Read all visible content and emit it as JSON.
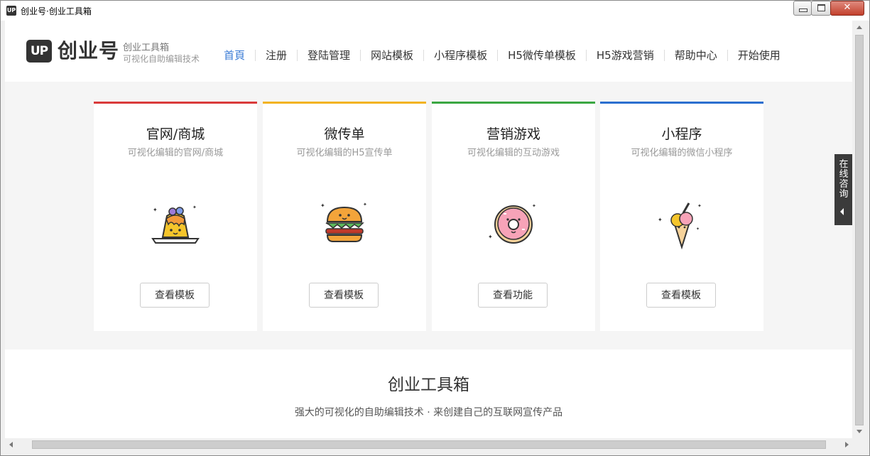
{
  "window": {
    "title": "创业号·创业工具箱",
    "icon": "UP"
  },
  "header": {
    "logo_mark": "UP",
    "logo_text": "创业号",
    "logo_sub1": "创业工具箱",
    "logo_sub2": "可视化自助编辑技术"
  },
  "nav": {
    "items": [
      {
        "label": "首頁"
      },
      {
        "label": "注册"
      },
      {
        "label": "登陆管理"
      },
      {
        "label": "网站模板"
      },
      {
        "label": "小程序模板"
      },
      {
        "label": "H5微传单模板"
      },
      {
        "label": "H5游戏营销"
      },
      {
        "label": "帮助中心"
      },
      {
        "label": "开始使用"
      }
    ],
    "active_color": "#3a7bd5"
  },
  "cards": [
    {
      "title": "官网/商城",
      "subtitle": "可视化编辑的官网/商城",
      "button": "查看模板",
      "accent": "#d93a3a",
      "icon": "pudding-icon"
    },
    {
      "title": "微传单",
      "subtitle": "可视化编辑的H5宣传单",
      "button": "查看模板",
      "accent": "#f2b322",
      "icon": "burger-icon"
    },
    {
      "title": "营销游戏",
      "subtitle": "可视化编辑的互动游戏",
      "button": "查看功能",
      "accent": "#3aa742",
      "icon": "donut-icon"
    },
    {
      "title": "小程序",
      "subtitle": "可视化编辑的微信小程序",
      "button": "查看模板",
      "accent": "#2b6fcf",
      "icon": "ice-cream-icon"
    }
  ],
  "section": {
    "title": "创业工具箱",
    "subtitle": "强大的可视化的自助编辑技术 · 来创建自己的互联网宣传产品"
  },
  "consult": {
    "label": "在线咨询"
  }
}
